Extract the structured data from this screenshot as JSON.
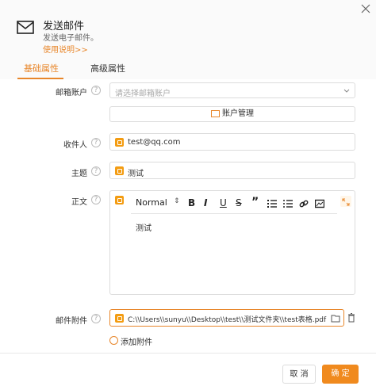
{
  "header": {
    "title": "发送邮件",
    "subtitle": "发送电子邮件。",
    "usage_link": "使用说明>>"
  },
  "tabs": [
    {
      "label": "基础属性",
      "active": true
    },
    {
      "label": "高级属性",
      "active": false
    }
  ],
  "form": {
    "account": {
      "label": "邮箱账户",
      "placeholder": "请选择邮箱账户"
    },
    "account_manage_button": "账户管理",
    "recipient": {
      "label": "收件人",
      "value": "test@qq.com"
    },
    "subject": {
      "label": "主题",
      "value": "测试"
    },
    "body": {
      "label": "正文",
      "format": "Normal",
      "content": "测试",
      "toolbar": [
        "B",
        "I",
        "U",
        "S",
        "”"
      ]
    },
    "attachment": {
      "label": "邮件附件",
      "value": "C:\\\\Users\\\\sunyu\\\\Desktop\\\\test\\\\测试文件夹\\\\test表格.pdf"
    },
    "add_attachment": "添加附件"
  },
  "footer": {
    "cancel": "取 消",
    "ok": "确 定"
  },
  "colors": {
    "accent": "#e8862a",
    "primary_button": "#f08a1e"
  }
}
